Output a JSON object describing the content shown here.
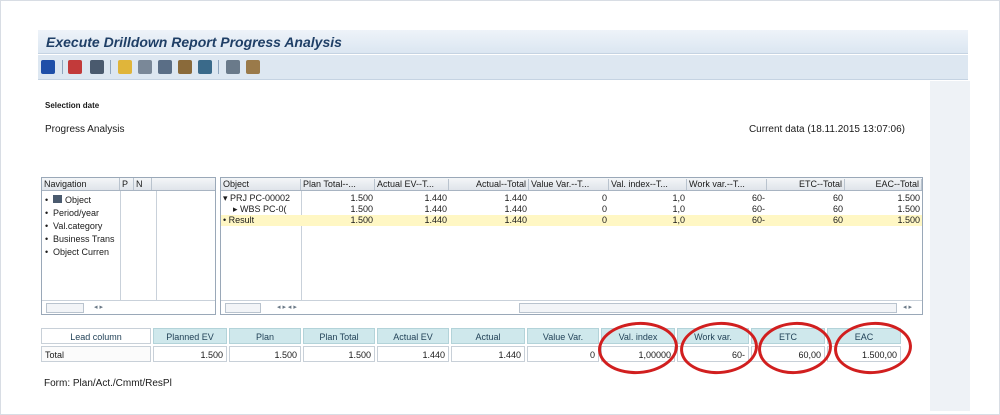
{
  "window": {
    "title": "Execute Drilldown Report Progress Analysis"
  },
  "toolbar": {
    "icons": [
      "info-icon",
      "calendar-icon",
      "hierarchy-icon",
      "layout-icon",
      "columns-icon",
      "export-icon",
      "edit-icon",
      "sort-icon",
      "print-preview-icon",
      "notes-icon"
    ]
  },
  "header": {
    "selection_label": "Selection date",
    "report_label": "Progress Analysis",
    "current_data": "Current data (18.11.2015 13:07:06)"
  },
  "navigation": {
    "columns": [
      "Navigation",
      "P",
      "N"
    ],
    "items": [
      "Object",
      "Period/year",
      "Val.category",
      "Business Trans",
      "Object Curren"
    ]
  },
  "grid": {
    "columns": [
      "Object",
      "Plan Total--...",
      "Actual EV--T...",
      "Actual--Total",
      "Value Var.--T...",
      "Val. index--T...",
      "Work var.--T...",
      "ETC--Total",
      "EAC--Total"
    ],
    "rows": [
      {
        "object": "PRJ PC-00002",
        "values": [
          "1.500",
          "1.440",
          "1.440",
          "0",
          "1,0",
          "60-",
          "60",
          "1.500"
        ]
      },
      {
        "object": "WBS PC-0(",
        "values": [
          "1.500",
          "1.440",
          "1.440",
          "0",
          "1,0",
          "60-",
          "60",
          "1.500"
        ]
      },
      {
        "object": "Result",
        "values": [
          "1.500",
          "1.440",
          "1.440",
          "0",
          "1,0",
          "60-",
          "60",
          "1.500"
        ]
      }
    ]
  },
  "key_figures": {
    "headers": [
      "Lead column",
      "Planned EV",
      "Plan",
      "Plan Total",
      "Actual EV",
      "Actual",
      "Value Var.",
      "Val. index",
      "Work var.",
      "ETC",
      "EAC"
    ],
    "row": [
      "Total",
      "1.500",
      "1.500",
      "1.500",
      "1.440",
      "1.440",
      "0",
      "1,00000",
      "60-",
      "60,00",
      "1.500,00"
    ]
  },
  "footer": {
    "form": "Form: Plan/Act./Cmmt/ResPl"
  },
  "colors": {
    "title": "#1f3f66",
    "result_row": "#fff7c4",
    "kf_header": "#cfe8ec",
    "annotation": "#d11f1f"
  }
}
